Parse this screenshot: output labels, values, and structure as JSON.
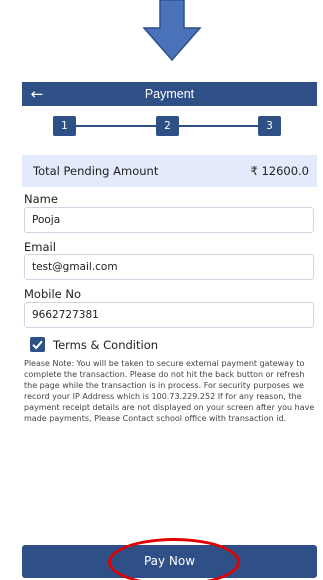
{
  "header": {
    "back_icon": "arrow-left-icon",
    "title": "Payment"
  },
  "steps": [
    "1",
    "2",
    "3"
  ],
  "amount": {
    "label": "Total Pending Amount",
    "value": "₹ 12600.0"
  },
  "form": {
    "name_label": "Name",
    "name_value": "Pooja",
    "email_label": "Email",
    "email_value": "test@gmail.com",
    "mobile_label": "Mobile No",
    "mobile_value": "9662727381"
  },
  "terms": {
    "checked": true,
    "label": "Terms & Condition"
  },
  "note": "Please Note: You will be taken to secure external payment gateway to complete the transaction. Please do not hit the back button or refresh the page while the transaction is in process. For security purposes we record your IP Address which is 100.73.229.252 If for any reason, the payment receipt details are not displayed on your screen after you have made payments, Please Contact school office with transaction id.",
  "pay_button": "Pay Now",
  "colors": {
    "primary": "#2f4f87",
    "amount_bg": "#e3eafc",
    "highlight": "#e00000",
    "arrow": "#4a72b8"
  }
}
